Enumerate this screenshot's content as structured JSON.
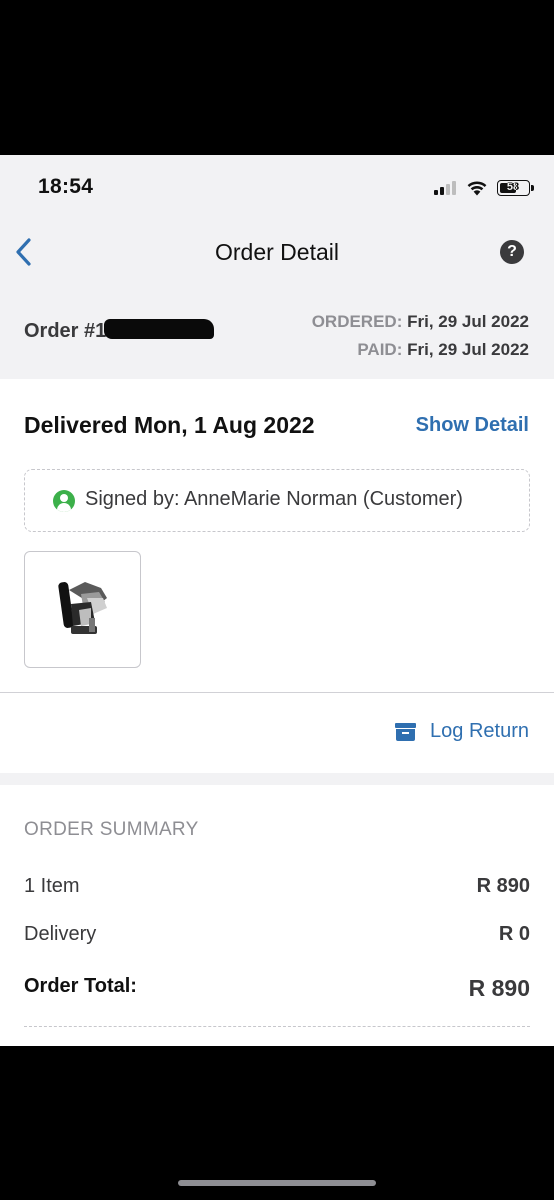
{
  "status_bar": {
    "time": "18:54",
    "battery": "58"
  },
  "nav": {
    "title": "Order Detail",
    "back_icon": "chevron-left-icon",
    "help_icon": "question-circle-icon",
    "help_glyph": "?"
  },
  "order": {
    "number_prefix": "Order #1",
    "ordered_label": "ORDERED:",
    "ordered_date": "Fri, 29 Jul 2022",
    "paid_label": "PAID:",
    "paid_date": "Fri, 29 Jul 2022"
  },
  "delivery": {
    "status": "Delivered Mon, 1 Aug 2022",
    "show_detail": "Show Detail",
    "signed_by": "Signed by: AnneMarie Norman (Customer)"
  },
  "actions": {
    "log_return": "Log Return"
  },
  "summary": {
    "title": "ORDER SUMMARY",
    "items_label": "1 Item",
    "items_value": "R 890",
    "delivery_label": "Delivery",
    "delivery_value": "R 0",
    "total_label": "Order Total:",
    "total_value": "R 890"
  },
  "colors": {
    "accent": "#2f6fb0",
    "signed_green": "#3cb04a",
    "header_bg": "#f2f2f4"
  }
}
